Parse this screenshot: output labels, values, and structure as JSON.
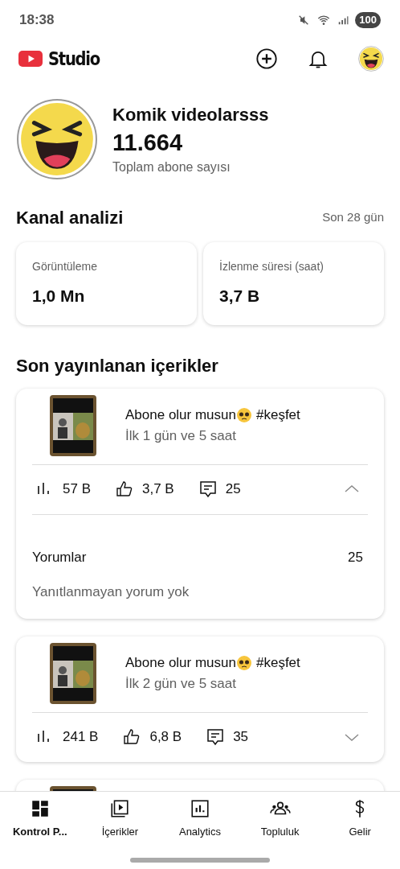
{
  "status_bar": {
    "time": "18:38",
    "battery": "100"
  },
  "app_bar": {
    "logo_text": "Studio"
  },
  "channel": {
    "name": "Komik videolarsss",
    "subscribers": "11.664",
    "subscribers_label": "Toplam abone sayısı"
  },
  "analytics": {
    "title": "Kanal analizi",
    "period": "Son 28 gün",
    "cards": [
      {
        "label": "Görüntüleme",
        "value": "1,0 Mn"
      },
      {
        "label": "İzlenme süresi (saat)",
        "value": "3,7 B"
      }
    ]
  },
  "recent": {
    "title": "Son yayınlanan içerikler",
    "videos": [
      {
        "title": "Abone olur musun",
        "title_suffix": "#keşfet",
        "period": "İlk 1 gün ve 5 saat",
        "views": "57 B",
        "likes": "3,7 B",
        "comments": "25",
        "expanded": true,
        "comments_label": "Yorumlar",
        "comments_count": "25",
        "comments_note": "Yanıtlanmayan yorum yok"
      },
      {
        "title": "Abone olur musun",
        "title_suffix": "#keşfet",
        "period": "İlk 2 gün ve 5 saat",
        "views": "241 B",
        "likes": "6,8 B",
        "comments": "35",
        "expanded": false
      }
    ]
  },
  "bottom_nav": [
    {
      "label": "Kontrol P...",
      "kind": "dashboard",
      "selected": true
    },
    {
      "label": "İçerikler",
      "kind": "content",
      "selected": false
    },
    {
      "label": "Analytics",
      "kind": "analytics",
      "selected": false
    },
    {
      "label": "Topluluk",
      "kind": "community",
      "selected": false
    },
    {
      "label": "Gelir",
      "kind": "earn",
      "selected": false
    }
  ]
}
